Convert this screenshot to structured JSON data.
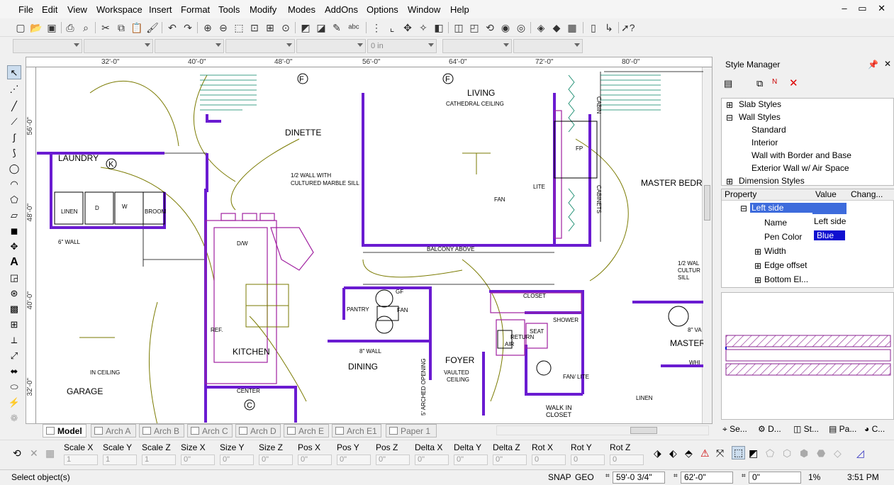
{
  "menu": [
    "File",
    "Edit",
    "View",
    "Workspace",
    "Insert",
    "Format",
    "Tools",
    "Modify",
    "Modes",
    "AddOns",
    "Options",
    "Window",
    "Help"
  ],
  "combos": {
    "offset_value": "0 in"
  },
  "ruler": {
    "h_ticks": [
      "32'-0\"",
      "40'-0\"",
      "48'-0\"",
      "56'-0\"",
      "64'-0\"",
      "72'-0\"",
      "80'-0\""
    ],
    "v_ticks": [
      "56'-0\"",
      "48'-0\"",
      "40'-0\"",
      "32'-0\""
    ]
  },
  "plan_labels": {
    "laundry": "LAUNDRY",
    "linen": "LINEN",
    "d": "D",
    "w": "W",
    "broom": "BROOM",
    "wall6": "6\" WALL",
    "dinette": "DINETTE",
    "half_wall": "1/2 WALL WITH",
    "cultured": "CULTURED MARBLE SILL",
    "living": "LIVING",
    "cathedral": "CATHEDRAL CEILING",
    "fan": "FAN",
    "lite": "LITE",
    "fp": "FP",
    "cabinets": "CABINETS",
    "master_bedr": "MASTER BEDR",
    "balcony": "BALCONY ABOVE",
    "dw": "D/W",
    "ref": "REF.",
    "kitchen": "KITCHEN",
    "center": "CENTER",
    "pantry": "PANTRY",
    "gf": "GF",
    "fan2": "FAN",
    "dining": "DINING",
    "wall8": "8\" WALL",
    "foyer": "FOYER",
    "vaulted": "VAULTED",
    "ceiling": "CEILING",
    "closet": "CLOSET",
    "seat": "SEAT",
    "shower": "SHOWER",
    "fan_lite": "FAN/ LITE",
    "linen2": "LINEN",
    "walk_in": "WALK IN",
    "closet2": "CLOSET",
    "master": "MASTER",
    "garage": "GARAGE",
    "in_ceiling": "IN CEILING",
    "arched": "5' ARCHED OPENING",
    "half_wall2": "1/2 WAL",
    "cultur2": "CULTUR",
    "sill2": "SILL",
    "air": "AIR",
    "return": "RETURN",
    "cab_top": "CABIN",
    "whi": "WHI",
    "wva": "8\" VA"
  },
  "tabs": [
    "Model",
    "Arch A",
    "Arch B",
    "Arch C",
    "Arch D",
    "Arch E",
    "Arch E1",
    "Paper 1"
  ],
  "style_manager": {
    "title": "Style Manager",
    "tree": [
      "Slab Styles",
      "Wall Styles",
      "Standard",
      "Interior",
      "Wall with Border and Base",
      "Exterior Wall w/ Air Space",
      "Dimension Styles"
    ],
    "prop_headers": [
      "Property",
      "Value",
      "Chang..."
    ],
    "props": [
      {
        "name": "Left side",
        "value": ""
      },
      {
        "name": "Name",
        "value": "Left side"
      },
      {
        "name": "Pen Color",
        "value": "Blue"
      },
      {
        "name": "Width",
        "value": ""
      },
      {
        "name": "Edge offset",
        "value": ""
      },
      {
        "name": "Bottom El...",
        "value": ""
      }
    ],
    "bottom_tabs": [
      "Se...",
      "D...",
      "St...",
      "Pa...",
      "C..."
    ]
  },
  "transform": {
    "labels": [
      "Scale X",
      "Scale Y",
      "Scale Z",
      "Size X",
      "Size Y",
      "Size Z",
      "Pos X",
      "Pos Y",
      "Pos Z",
      "Delta X",
      "Delta Y",
      "Delta Z",
      "Rot X",
      "Rot Y",
      "Rot Z"
    ],
    "values": [
      "1",
      "1",
      "1",
      "0\"",
      "0\"",
      "0\"",
      "0\"",
      "0\"",
      "0\"",
      "0\"",
      "0\"",
      "0\"",
      "0",
      "0",
      "0"
    ]
  },
  "status": {
    "message": "Select object(s)",
    "snap": "SNAP",
    "geo": "GEO",
    "x": "59'-0 3/4\"",
    "y": "62'-0\"",
    "z": "0\"",
    "zoom": "1%",
    "time": "3:51 PM"
  },
  "colors": {
    "wall": "#6a1bd1",
    "cabinet": "#a020a0",
    "fixture": "#7a7a00",
    "highlight": "#3d6bdc"
  }
}
